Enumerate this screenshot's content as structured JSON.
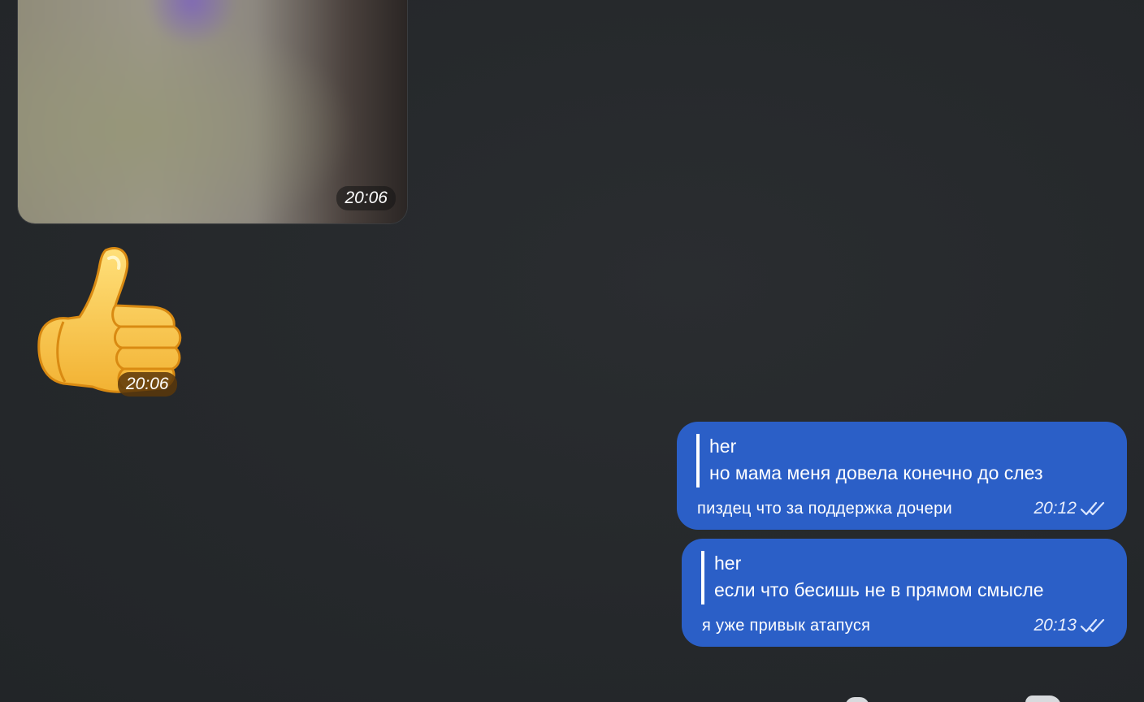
{
  "photo_message": {
    "time": "20:06"
  },
  "sticker_message": {
    "emoji": "thumbs-up",
    "time": "20:06"
  },
  "messages": [
    {
      "reply_name": "her",
      "reply_text": "но мама меня довела конечно до слез",
      "text": "пиздец что за поддержка дочери",
      "time": "20:12",
      "status": "read"
    },
    {
      "reply_name": "her",
      "reply_text": "если что бесишь не в прямом смысле",
      "text": "я уже привык атапуся",
      "time": "20:13",
      "status": "read"
    }
  ],
  "colors": {
    "background": "#25282b",
    "outgoing_bubble": "#2b5fc7"
  }
}
